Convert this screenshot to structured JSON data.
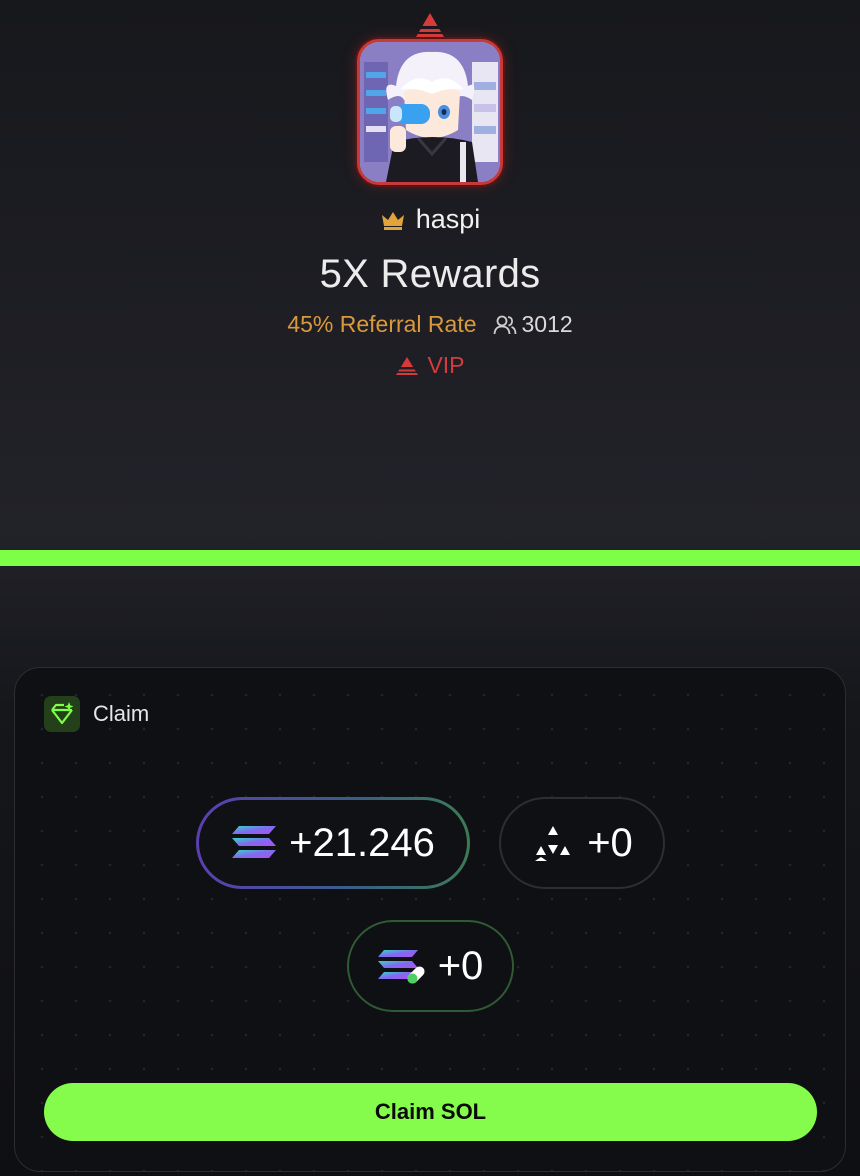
{
  "profile": {
    "username": "haspi",
    "title": "5X Rewards",
    "referral_rate": "45% Referral Rate",
    "referral_count": "3012",
    "tier_label": "VIP"
  },
  "colors": {
    "accent_green": "#85fc4b",
    "vip_red": "#d23c3c",
    "referral_gold": "#d99a3b"
  },
  "claim_card": {
    "header": "Claim",
    "rewards": [
      {
        "icon": "solana-icon",
        "value": "+21.246"
      },
      {
        "icon": "triangle-token-icon",
        "value": "+0"
      },
      {
        "icon": "staked-sol-icon",
        "value": "+0"
      }
    ],
    "button_label": "Claim SOL"
  }
}
